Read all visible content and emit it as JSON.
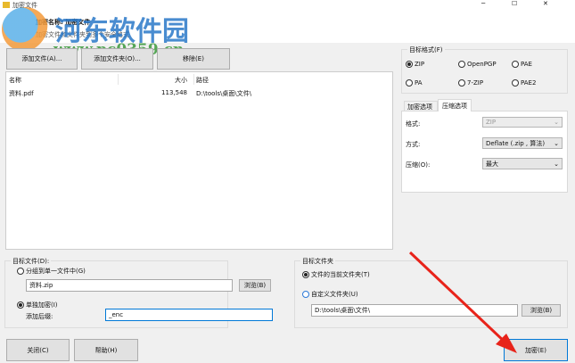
{
  "window": {
    "title": "加密文件",
    "min": "─",
    "max": "☐",
    "close": "✕"
  },
  "header": {
    "title": "加密名称: 加密文件",
    "subtitle": "加密文件和文件夹到多个安全格式"
  },
  "watermark": {
    "name": "河东软件园",
    "url": "www.pc0359.cn"
  },
  "toolbar": {
    "add_file": "添加文件(A)...",
    "add_folder": "添加文件夹(O)...",
    "remove": "移除(E)"
  },
  "file_list": {
    "columns": [
      "名称",
      "大小",
      "路径"
    ],
    "rows": [
      {
        "name": "资料.pdf",
        "size": "113,548",
        "path": "D:\\tools\\桌面\\文件\\"
      }
    ]
  },
  "target_format": {
    "label": "目标格式(F)",
    "options": [
      {
        "label": "ZIP",
        "checked": true
      },
      {
        "label": "OpenPGP",
        "checked": false
      },
      {
        "label": "PAE",
        "checked": false
      },
      {
        "label": "PA",
        "checked": false
      },
      {
        "label": "7-ZIP",
        "checked": false
      },
      {
        "label": "PAE2",
        "checked": false
      }
    ]
  },
  "tabs": [
    {
      "label": "加密选项",
      "active": false
    },
    {
      "label": "压缩选项",
      "active": true
    }
  ],
  "compression": {
    "format_label": "格式:",
    "format_value": "ZIP",
    "method_label": "方式:",
    "method_value": "Deflate (.zip , 算法)",
    "level_label": "压缩(O):",
    "level_value": "最大"
  },
  "target_file": {
    "label": "目标文件(D):",
    "single_label": "分组到单一文件中(G)",
    "single_value": "资料.zip",
    "browse": "浏览(B)",
    "separate_label": "单独加密(I)",
    "suffix_label": "添加后缀:",
    "suffix_value": "_enc"
  },
  "target_folder": {
    "label": "目标文件夹",
    "current_label": "文件的当前文件夹(T)",
    "custom_label": "自定义文件夹(U)",
    "custom_value": "D:\\tools\\桌面\\文件\\",
    "browse": "浏览(B)"
  },
  "footer": {
    "close": "关闭(C)",
    "help": "帮助(H)",
    "encrypt": "加密(E)"
  },
  "colors": {
    "accent": "#0078d7",
    "arrow": "#e8231a"
  }
}
